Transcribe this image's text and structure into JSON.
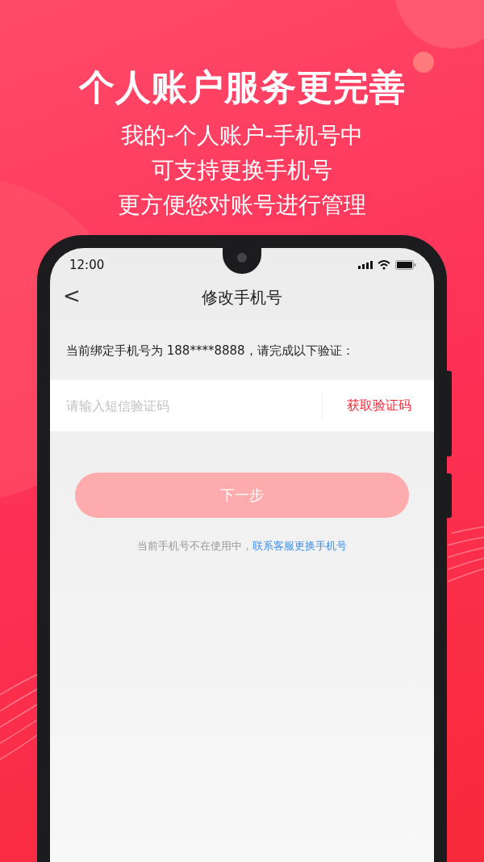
{
  "headline": "个人账户服务更完善",
  "subtitle_lines": [
    "我的-个人账户-手机号中",
    "可支持更换手机号",
    "更方便您对账号进行管理"
  ],
  "status_bar": {
    "time": "12:00"
  },
  "nav_bar": {
    "back": "<",
    "title": "修改手机号"
  },
  "notice": "当前绑定手机号为 188****8888，请完成以下验证：",
  "code_field": {
    "placeholder": "请输入短信验证码",
    "action": "获取验证码"
  },
  "next_button": {
    "label": "下一步",
    "disabled": true
  },
  "help": {
    "text": "当前手机号不在使用中，",
    "link": "联系客服更换手机号"
  }
}
